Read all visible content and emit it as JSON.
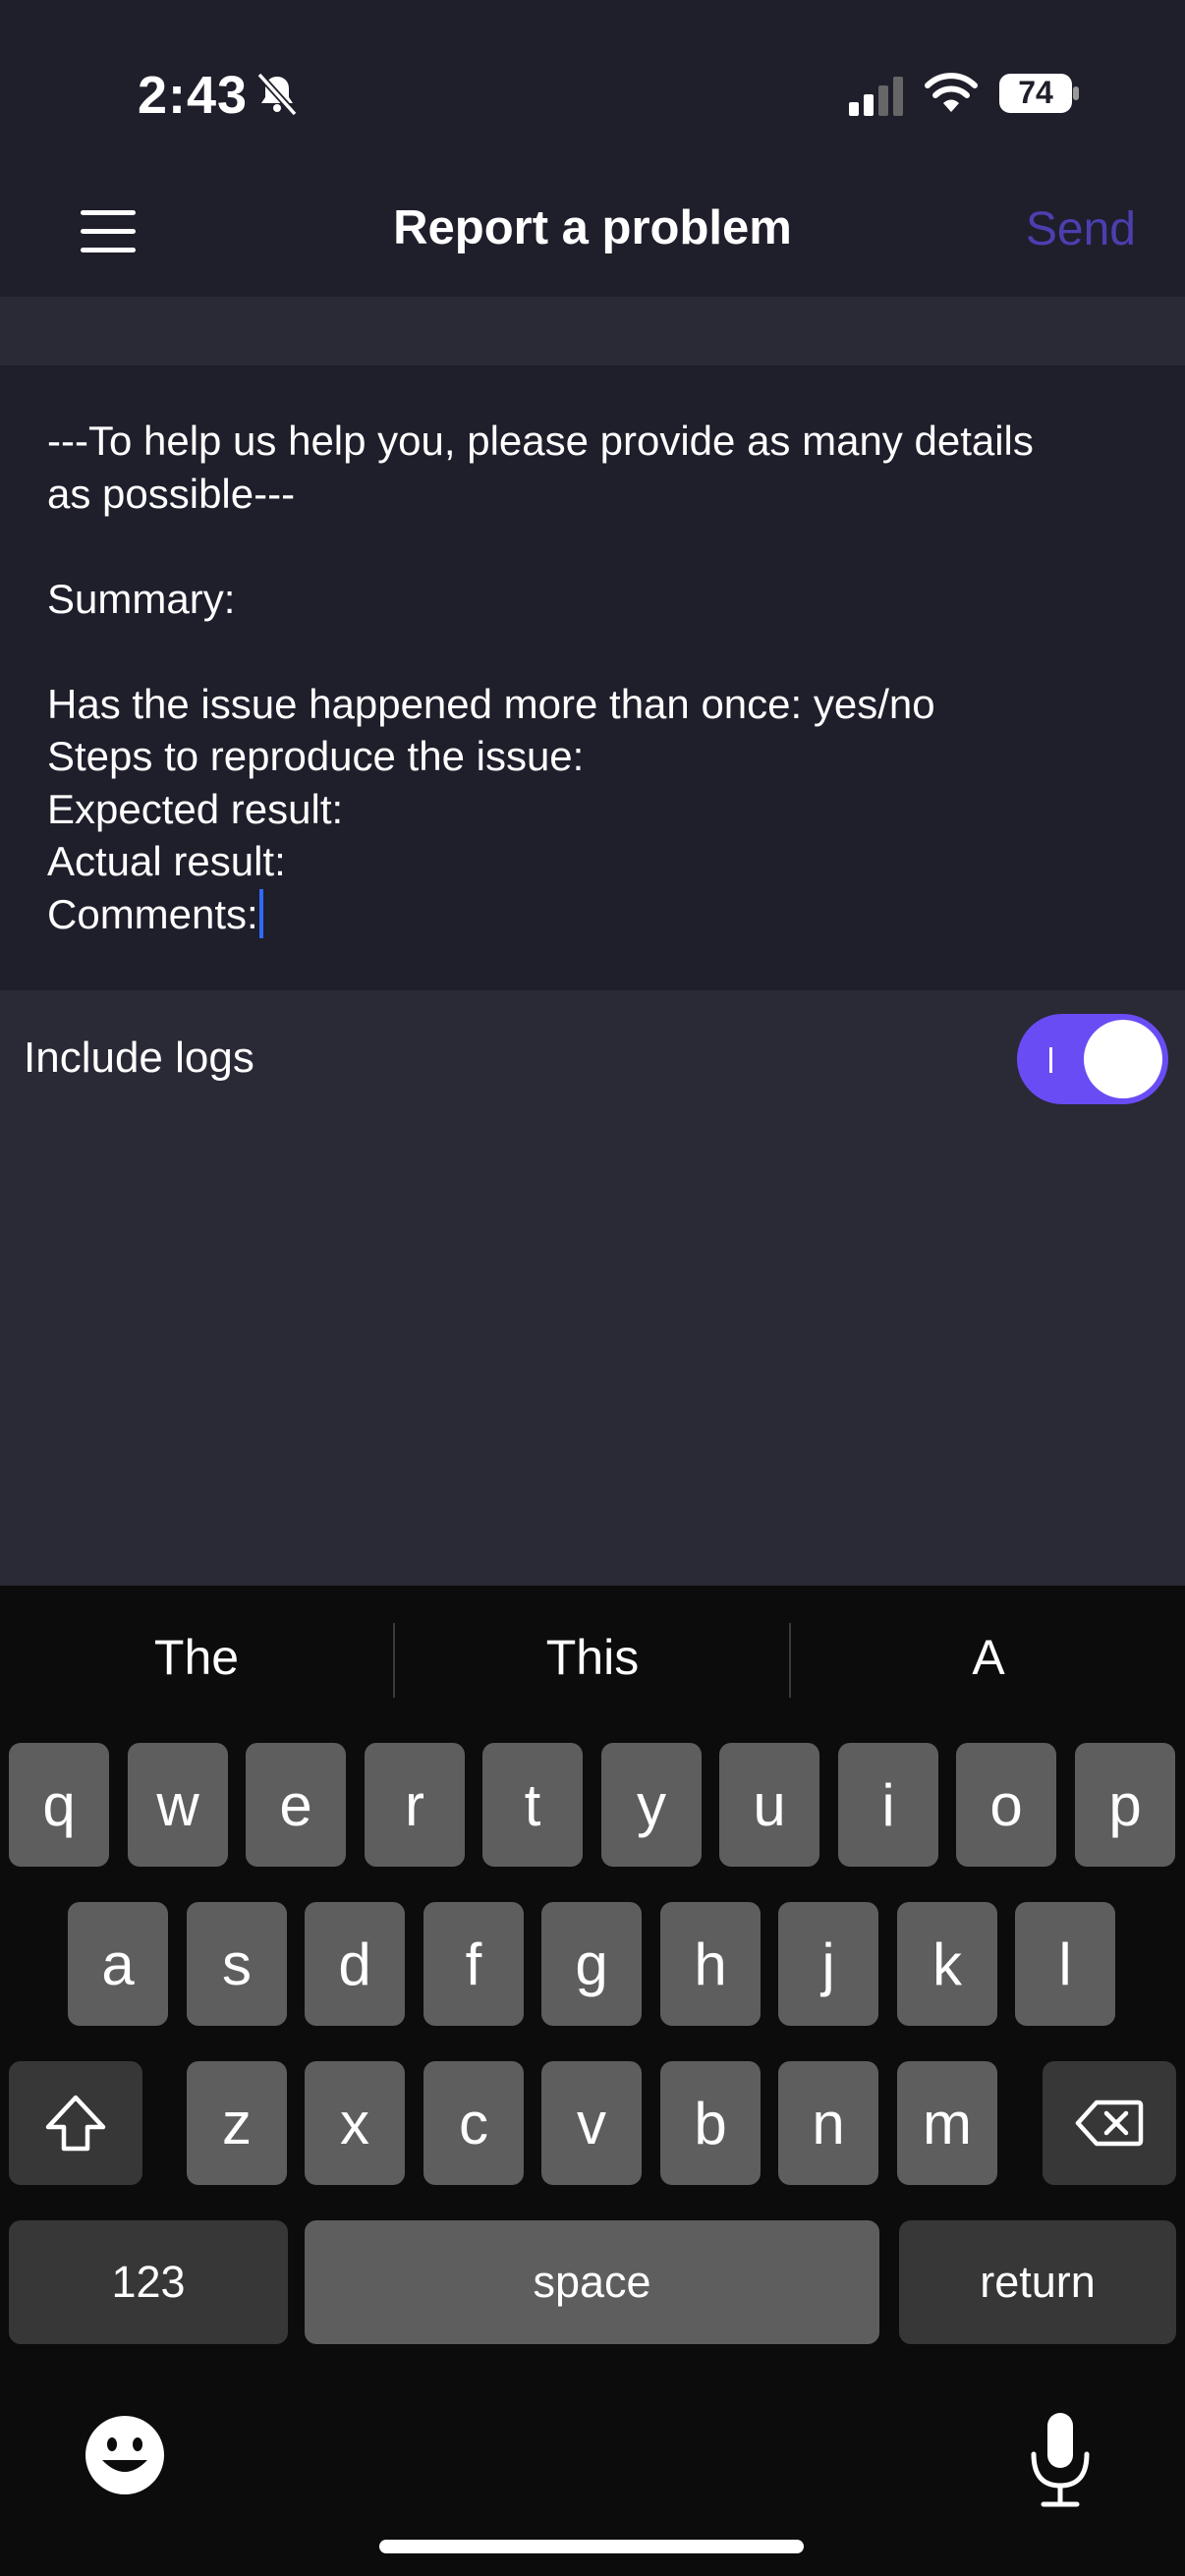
{
  "status_bar": {
    "time": "2:43",
    "battery": "74"
  },
  "nav": {
    "title": "Report a problem",
    "send_label": "Send"
  },
  "editor": {
    "lines": [
      "---To help us help you, please provide as many details",
      "as possible---",
      "",
      "Summary:",
      "",
      "Has the issue happened more than once: yes/no",
      "Steps to reproduce the issue:",
      "Expected result:",
      "Actual result:",
      "Comments:"
    ]
  },
  "settings": {
    "include_logs_label": "Include logs",
    "include_logs_enabled": true
  },
  "keyboard": {
    "suggestions": [
      "The",
      "This",
      "A"
    ],
    "row1": [
      "q",
      "w",
      "e",
      "r",
      "t",
      "y",
      "u",
      "i",
      "o",
      "p"
    ],
    "row2": [
      "a",
      "s",
      "d",
      "f",
      "g",
      "h",
      "j",
      "k",
      "l"
    ],
    "row3": [
      "z",
      "x",
      "c",
      "v",
      "b",
      "n",
      "m"
    ],
    "numbers_label": "123",
    "space_label": "space",
    "return_label": "return"
  },
  "colors": {
    "background": "#1f1e2b",
    "panel": "#2a2936",
    "accent": "#6a4cf5",
    "send_disabled": "#4b3fb0"
  }
}
